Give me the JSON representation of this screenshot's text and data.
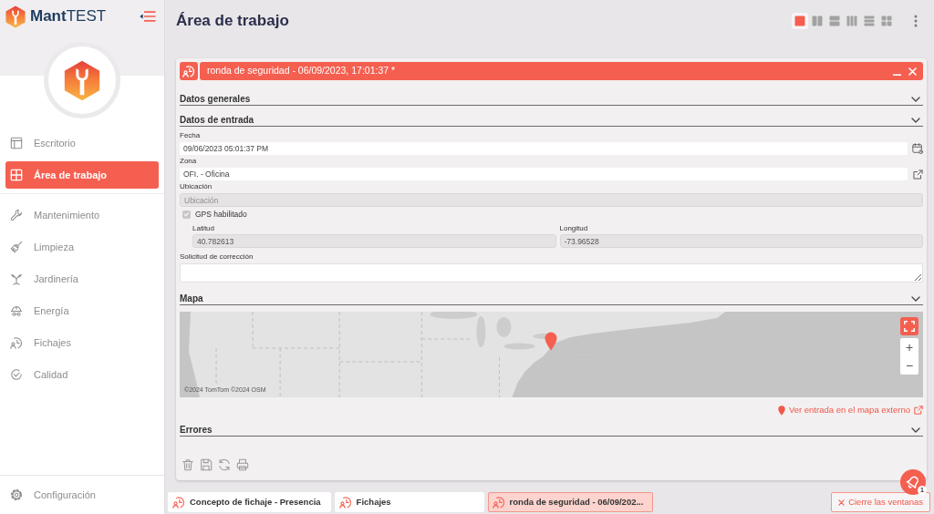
{
  "app": {
    "logo_text": "**Mant**TEST"
  },
  "sidebar": {
    "groups": [
      {
        "items": [
          {
            "label": "Escritorio",
            "selected": false
          },
          {
            "label": "Área de trabajo",
            "selected": true
          }
        ]
      },
      {
        "items": [
          {
            "label": "Mantenimiento",
            "selected": false
          },
          {
            "label": "Limpieza",
            "selected": false
          },
          {
            "label": "Jardinería",
            "selected": false
          },
          {
            "label": "Energía",
            "selected": false
          },
          {
            "label": "Fichajes",
            "selected": false
          },
          {
            "label": "Calidad",
            "selected": false
          }
        ]
      }
    ],
    "settings": {
      "label": "Configuración"
    }
  },
  "page_title": "Área de trabajo",
  "layouts": [
    {
      "selected": true
    },
    {
      "selected": false
    },
    {
      "selected": false
    },
    {
      "selected": false
    },
    {
      "selected": false
    },
    {
      "selected": false
    }
  ],
  "panel": {
    "title": "ronda de seguridad - 06/09/2023, 17:01:37 *",
    "sections": [
      {
        "title": "Datos generales"
      },
      {
        "title": "Datos de entrada",
        "fields": [
          {
            "kind": "date",
            "label": "Fecha",
            "value": "09/06/2023 05:01:37 PM"
          },
          {
            "kind": "lookup",
            "label": "Zona",
            "value": "OFI. - Oficina"
          },
          {
            "kind": "text",
            "label": "Ubicación",
            "placeholder": "Ubicación",
            "disabled": true
          },
          {
            "kind": "checkbox",
            "label": "GPS habilitado",
            "checked": true,
            "disabled": true
          },
          {
            "kind": "pair",
            "items": [
              {
                "label": "Latitud",
                "value": "40.782613",
                "disabled": true
              },
              {
                "label": "Longitud",
                "value": "-73.96528",
                "disabled": true
              }
            ]
          },
          {
            "kind": "textarea",
            "label": "Solicitud de corrección"
          }
        ]
      },
      {
        "title": "Mapa",
        "map": {
          "attribution": "©2024 TomTom ©2024 OSM",
          "zoom_in": "+",
          "zoom_out": "−",
          "link": "Ver entrada en el mapa externo"
        }
      },
      {
        "title": "Errores"
      }
    ]
  },
  "notifications": {
    "count": "1"
  },
  "taskbar": {
    "windows": [
      {
        "title": "Concepto de fichaje - Presencia",
        "selected": false
      },
      {
        "title": "Fichajes",
        "selected": false
      },
      {
        "title": "ronda de seguridad - 06/09/202...",
        "selected": true
      }
    ],
    "close_all": "Cierre las ventanas"
  }
}
